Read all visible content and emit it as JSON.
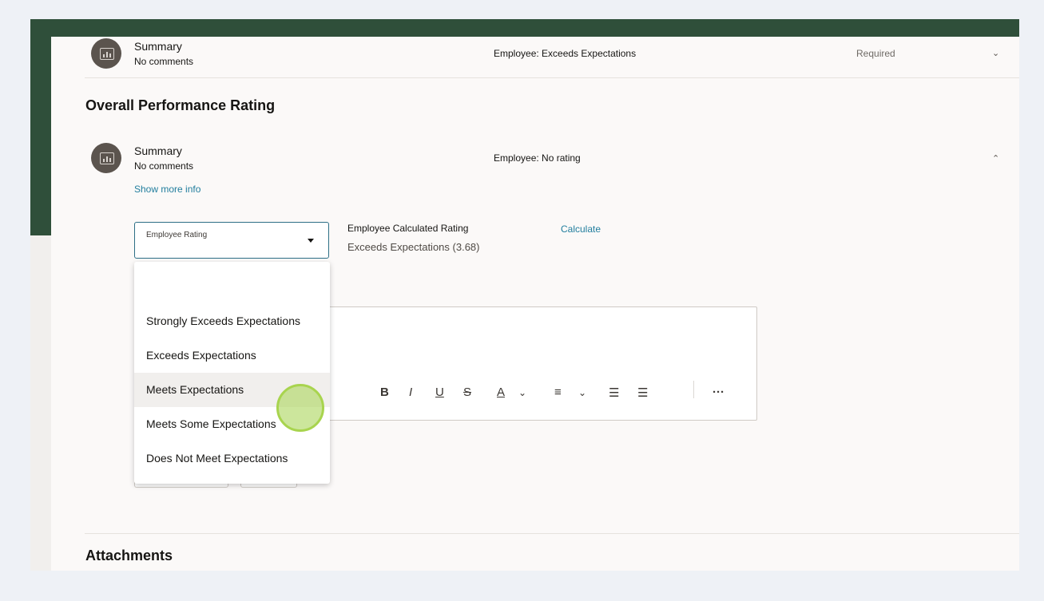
{
  "goal_row": {
    "title": "Summary",
    "comment": "No comments",
    "rating_text": "Employee: Exceeds Expectations",
    "required_text": "Required",
    "chevron": "chevron-down-icon"
  },
  "overall": {
    "heading": "Overall Performance Rating",
    "title": "Summary",
    "comment": "No comments",
    "rating_text": "Employee: No rating",
    "chevron": "chevron-up-icon",
    "show_more": "Show more info"
  },
  "rating_select": {
    "label": "Employee Rating",
    "value": ""
  },
  "calculated": {
    "label": "Employee Calculated Rating",
    "value": "Exceeds Expectations (3.68)",
    "calculate_link": "Calculate"
  },
  "dropdown": {
    "options": [
      {
        "label": ""
      },
      {
        "label": "Strongly Exceeds Expectations"
      },
      {
        "label": "Exceeds Expectations"
      },
      {
        "label": "Meets Expectations"
      },
      {
        "label": "Meets Some Expectations"
      },
      {
        "label": "Does Not Meet Expectations"
      }
    ],
    "hovered_index": 3
  },
  "editor_toolbar": {
    "bold": "B",
    "italic": "I",
    "underline": "U",
    "strikethrough": "S",
    "font_color": "A",
    "more": "···"
  },
  "attachments": {
    "heading": "Attachments"
  },
  "colors": {
    "brand_green": "#2f4f3a",
    "link": "#227e9e",
    "click_highlight": "#a8d44e"
  }
}
